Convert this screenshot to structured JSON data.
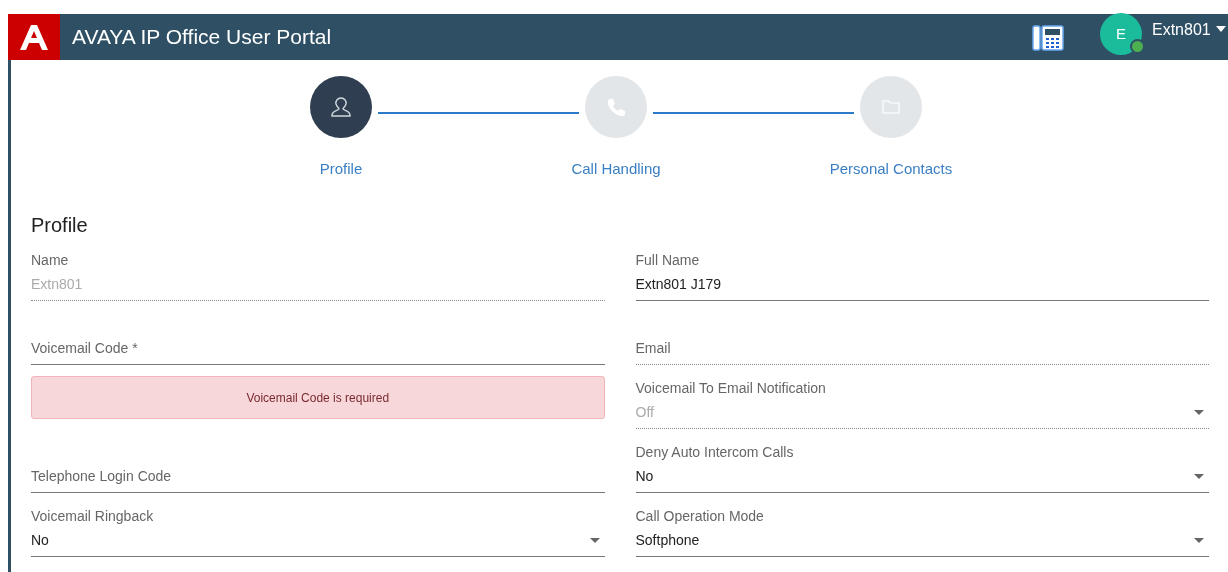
{
  "header": {
    "title": "AVAYA IP Office User Portal",
    "user": {
      "initial": "E",
      "name": "Extn801",
      "online": true
    }
  },
  "steps": [
    {
      "label": "Profile",
      "selected": true
    },
    {
      "label": "Call Handling",
      "selected": false
    },
    {
      "label": "Personal Contacts",
      "selected": false
    }
  ],
  "section_title": "Profile",
  "left_fields": [
    {
      "kind": "text",
      "label": "Name",
      "value": "Extn801",
      "disabled": true
    },
    {
      "kind": "text",
      "label": "Voicemail Code *",
      "disabled": false
    },
    {
      "kind": "error",
      "message": "Voicemail Code is required"
    },
    {
      "kind": "text",
      "label": "Telephone Login Code",
      "disabled": false
    },
    {
      "kind": "select",
      "label": "Voicemail Ringback",
      "value": "No",
      "disabled": false
    }
  ],
  "right_fields": [
    {
      "kind": "text",
      "label": "Full Name",
      "value": "Extn801 J179",
      "disabled": false
    },
    {
      "kind": "text",
      "label": "Email",
      "disabled": true
    },
    {
      "kind": "select",
      "label": "Voicemail To Email Notification",
      "value": "Off",
      "disabled": true
    },
    {
      "kind": "select",
      "label": "Deny Auto Intercom Calls",
      "value": "No",
      "disabled": false
    },
    {
      "kind": "select",
      "label": "Call Operation Mode",
      "value": "Softphone",
      "disabled": false
    }
  ]
}
